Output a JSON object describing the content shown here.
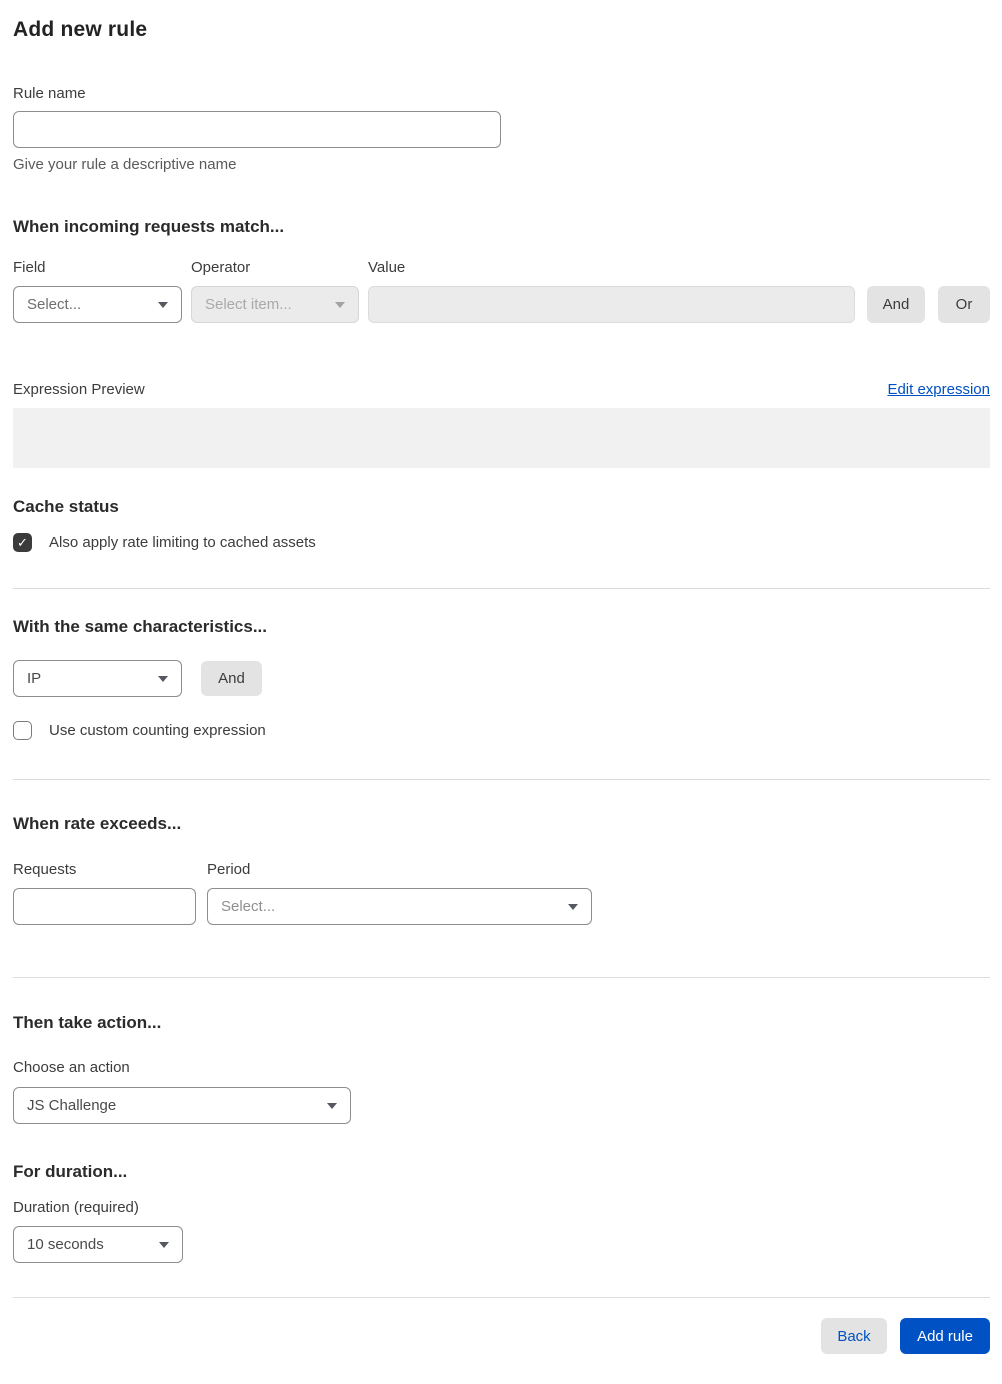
{
  "page": {
    "title": "Add new rule"
  },
  "rule_name": {
    "label": "Rule name",
    "value": "",
    "helper": "Give your rule a descriptive name"
  },
  "match_section": {
    "title": "When incoming requests match...",
    "field": {
      "label": "Field",
      "selected": "Select..."
    },
    "operator": {
      "label": "Operator",
      "selected": "Select item..."
    },
    "value": {
      "label": "Value",
      "value": ""
    },
    "and_button": "And",
    "or_button": "Or"
  },
  "expression": {
    "preview_label": "Expression Preview",
    "edit_link": "Edit expression",
    "preview_value": ""
  },
  "cache_status": {
    "title": "Cache status",
    "checkbox_label": "Also apply rate limiting to cached assets",
    "checked": true
  },
  "characteristics": {
    "title": "With the same characteristics...",
    "select_selected": "IP",
    "and_button": "And",
    "checkbox_label": "Use custom counting expression",
    "checked": false
  },
  "rate": {
    "title": "When rate exceeds...",
    "requests": {
      "label": "Requests",
      "value": ""
    },
    "period": {
      "label": "Period",
      "selected": "Select..."
    }
  },
  "action": {
    "title": "Then take action...",
    "choose_label": "Choose an action",
    "selected": "JS Challenge"
  },
  "duration": {
    "title": "For duration...",
    "label": "Duration (required)",
    "selected": "10 seconds"
  },
  "footer": {
    "back_button": "Back",
    "add_rule_button": "Add rule"
  },
  "icons": {
    "check_glyph": "✓"
  },
  "colors": {
    "accent_blue": "#0051c3",
    "disabled_bg": "#ebebeb",
    "checkbox_checked": "#3b3b3b",
    "divider": "#dcdcdc",
    "preview_bg": "#f1f1f1"
  }
}
